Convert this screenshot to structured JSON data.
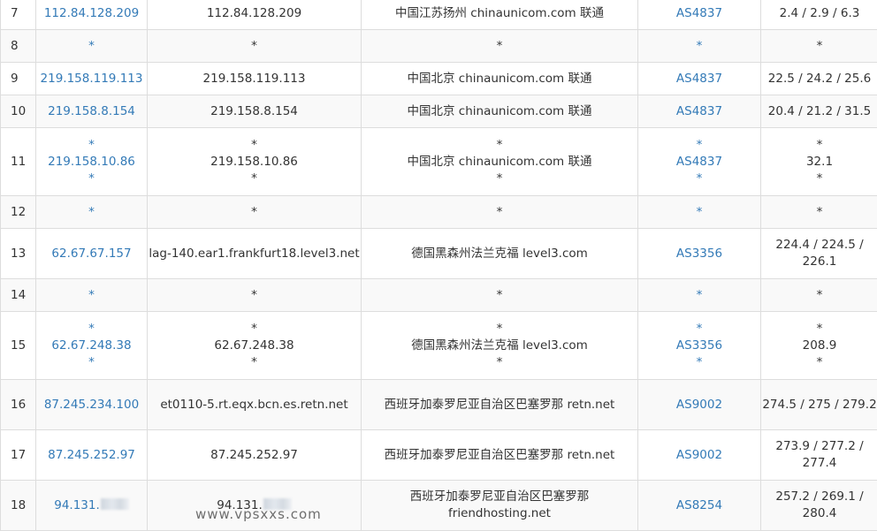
{
  "rows": [
    {
      "hop": "7",
      "ip": [
        "112.84.128.209"
      ],
      "host": [
        "112.84.128.209"
      ],
      "loc": [
        "中国江苏扬州 chinaunicom.com 联通"
      ],
      "asn": [
        "AS4837"
      ],
      "time": [
        "2.4 / 2.9 / 6.3"
      ]
    },
    {
      "hop": "8",
      "ip": [
        "*"
      ],
      "host": [
        "*"
      ],
      "loc": [
        "*"
      ],
      "asn": [
        "*"
      ],
      "time": [
        "*"
      ]
    },
    {
      "hop": "9",
      "ip": [
        "219.158.119.113"
      ],
      "host": [
        "219.158.119.113"
      ],
      "loc": [
        "中国北京 chinaunicom.com 联通"
      ],
      "asn": [
        "AS4837"
      ],
      "time": [
        "22.5 / 24.2 / 25.6"
      ]
    },
    {
      "hop": "10",
      "ip": [
        "219.158.8.154"
      ],
      "host": [
        "219.158.8.154"
      ],
      "loc": [
        "中国北京 chinaunicom.com 联通"
      ],
      "asn": [
        "AS4837"
      ],
      "time": [
        "20.4 / 21.2 / 31.5"
      ]
    },
    {
      "hop": "11",
      "ip": [
        "*",
        "219.158.10.86",
        "*"
      ],
      "host": [
        "*",
        "219.158.10.86",
        "*"
      ],
      "loc": [
        "*",
        "中国北京 chinaunicom.com 联通",
        "*"
      ],
      "asn": [
        "*",
        "AS4837",
        "*"
      ],
      "time": [
        "*",
        "32.1",
        "*"
      ]
    },
    {
      "hop": "12",
      "ip": [
        "*"
      ],
      "host": [
        "*"
      ],
      "loc": [
        "*"
      ],
      "asn": [
        "*"
      ],
      "time": [
        "*"
      ]
    },
    {
      "hop": "13",
      "ip": [
        "62.67.67.157"
      ],
      "host": [
        "lag-140.ear1.frankfurt18.level3.net"
      ],
      "loc": [
        "德国黑森州法兰克福 level3.com"
      ],
      "asn": [
        "AS3356"
      ],
      "time": [
        "224.4 / 224.5 / 226.1"
      ]
    },
    {
      "hop": "14",
      "ip": [
        "*"
      ],
      "host": [
        "*"
      ],
      "loc": [
        "*"
      ],
      "asn": [
        "*"
      ],
      "time": [
        "*"
      ]
    },
    {
      "hop": "15",
      "ip": [
        "*",
        "62.67.248.38",
        "*"
      ],
      "host": [
        "*",
        "62.67.248.38",
        "*"
      ],
      "loc": [
        "*",
        "德国黑森州法兰克福 level3.com",
        "*"
      ],
      "asn": [
        "*",
        "AS3356",
        "*"
      ],
      "time": [
        "*",
        "208.9",
        "*"
      ]
    },
    {
      "hop": "16",
      "ip": [
        "87.245.234.100"
      ],
      "host": [
        "et0110-5.rt.eqx.bcn.es.retn.net"
      ],
      "loc": [
        "西班牙加泰罗尼亚自治区巴塞罗那 retn.net"
      ],
      "asn": [
        "AS9002"
      ],
      "time": [
        "274.5 / 275 / 279.2"
      ]
    },
    {
      "hop": "17",
      "ip": [
        "87.245.252.97"
      ],
      "host": [
        "87.245.252.97"
      ],
      "loc": [
        "西班牙加泰罗尼亚自治区巴塞罗那 retn.net"
      ],
      "asn": [
        "AS9002"
      ],
      "time": [
        "273.9 / 277.2 / 277.4"
      ]
    },
    {
      "hop": "18",
      "ip": [
        "94.131."
      ],
      "host": [
        "94.131."
      ],
      "loc": [
        "西班牙加泰罗尼亚自治区巴塞罗那 friendhosting.net"
      ],
      "asn": [
        "AS8254"
      ],
      "time": [
        "257.2 / 269.1 / 280.4"
      ],
      "redacted": true
    }
  ],
  "watermark": "www.vpsxxs.com",
  "colors": {
    "link": "#337ab7",
    "text": "#333333",
    "border": "#dddddd",
    "stripe": "#f9f9f9"
  }
}
